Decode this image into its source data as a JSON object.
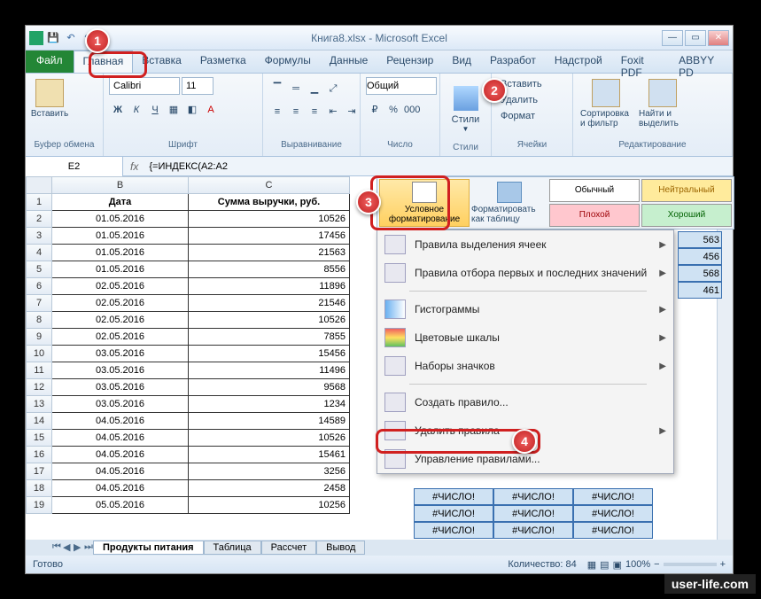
{
  "title": "Книга8.xlsx - Microsoft Excel",
  "tabs": {
    "file": "Файл",
    "home": "Главная",
    "insert": "Вставка",
    "layout": "Разметка",
    "formulas": "Формулы",
    "data": "Данные",
    "review": "Рецензир",
    "view": "Вид",
    "dev": "Разработ",
    "addins": "Надстрой",
    "foxit": "Foxit PDF",
    "abbyy": "ABBYY PD"
  },
  "groups": {
    "clipboard": "Буфер обмена",
    "font": "Шрифт",
    "align": "Выравнивание",
    "number": "Число",
    "styles": "Стили",
    "cells": "Ячейки",
    "editing": "Редактирование"
  },
  "paste": "Вставить",
  "font": {
    "name": "Calibri",
    "size": "11"
  },
  "num_format": "Общий",
  "cells": {
    "insert": "Вставить",
    "delete": "Удалить",
    "format": "Формат"
  },
  "sort": "Сортировка и фильтр",
  "find": "Найти и выделить",
  "styles_btn": "Стили",
  "namebox": "E2",
  "formula": "{=ИНДЕКС(A2:A2",
  "cols": {
    "b_w": 154,
    "c_w": 182
  },
  "headers": {
    "date": "Дата",
    "rev": "Сумма выручки, руб."
  },
  "rows": [
    {
      "r": "1"
    },
    {
      "r": "2",
      "b": "01.05.2016",
      "c": "10526"
    },
    {
      "r": "3",
      "b": "01.05.2016",
      "c": "17456"
    },
    {
      "r": "4",
      "b": "01.05.2016",
      "c": "21563"
    },
    {
      "r": "5",
      "b": "01.05.2016",
      "c": "8556"
    },
    {
      "r": "6",
      "b": "02.05.2016",
      "c": "11896"
    },
    {
      "r": "7",
      "b": "02.05.2016",
      "c": "21546"
    },
    {
      "r": "8",
      "b": "02.05.2016",
      "c": "10526"
    },
    {
      "r": "9",
      "b": "02.05.2016",
      "c": "7855"
    },
    {
      "r": "10",
      "b": "03.05.2016",
      "c": "15456"
    },
    {
      "r": "11",
      "b": "03.05.2016",
      "c": "11496"
    },
    {
      "r": "12",
      "b": "03.05.2016",
      "c": "9568"
    },
    {
      "r": "13",
      "b": "03.05.2016",
      "c": "1234"
    },
    {
      "r": "14",
      "b": "04.05.2016",
      "c": "14589"
    },
    {
      "r": "15",
      "b": "04.05.2016",
      "c": "10526"
    },
    {
      "r": "16",
      "b": "04.05.2016",
      "c": "15461"
    },
    {
      "r": "17",
      "b": "04.05.2016",
      "c": "3256"
    },
    {
      "r": "18",
      "b": "04.05.2016",
      "c": "2458"
    },
    {
      "r": "19",
      "b": "05.05.2016",
      "c": "10256"
    }
  ],
  "err": "#ЧИСЛО!",
  "styles_panel": {
    "cf": "Условное форматирование",
    "fmt": "Форматировать как таблицу",
    "normal": "Обычный",
    "neutral": "Нейтральный",
    "bad": "Плохой",
    "good": "Хороший"
  },
  "menu": {
    "highlight": "Правила выделения ячеек",
    "toprules": "Правила отбора первых и последних значений",
    "databars": "Гистограммы",
    "colorscales": "Цветовые шкалы",
    "iconsets": "Наборы значков",
    "newrule": "Создать правило...",
    "clear": "Удалить правила",
    "manage": "Управление правилами..."
  },
  "sheets": {
    "s1": "Продукты питания",
    "s2": "Таблица",
    "s3": "Рассчет",
    "s4": "Вывод"
  },
  "status": {
    "ready": "Готово",
    "count": "Количество: 84",
    "zoom": "100%"
  },
  "right_vals": [
    "563",
    "456",
    "568",
    "461"
  ],
  "watermark": "user-life.com"
}
